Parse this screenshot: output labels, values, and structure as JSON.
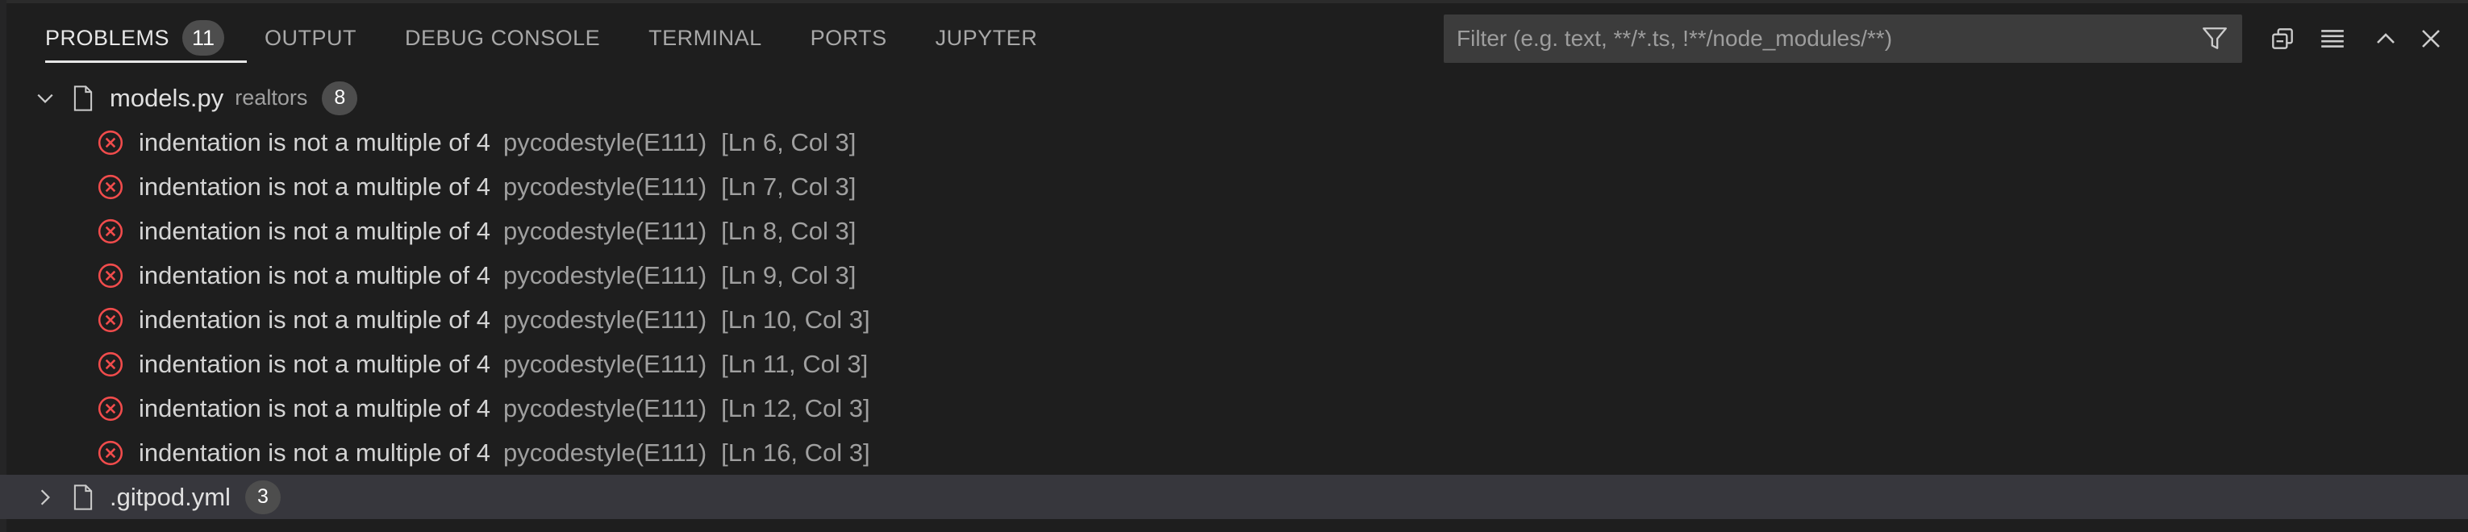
{
  "panel_tabs": [
    {
      "label": "PROBLEMS",
      "active": true,
      "badge": "11"
    },
    {
      "label": "OUTPUT"
    },
    {
      "label": "DEBUG CONSOLE"
    },
    {
      "label": "TERMINAL"
    },
    {
      "label": "PORTS"
    },
    {
      "label": "JUPYTER"
    }
  ],
  "filter": {
    "placeholder": "Filter (e.g. text, **/*.ts, !**/node_modules/**)"
  },
  "files": [
    {
      "name": "models.py",
      "folder": "realtors",
      "count": "8",
      "expanded": true,
      "problems": [
        {
          "message": "indentation is not a multiple of 4",
          "source": "pycodestyle(E111)",
          "location": "[Ln 6, Col 3]"
        },
        {
          "message": "indentation is not a multiple of 4",
          "source": "pycodestyle(E111)",
          "location": "[Ln 7, Col 3]"
        },
        {
          "message": "indentation is not a multiple of 4",
          "source": "pycodestyle(E111)",
          "location": "[Ln 8, Col 3]"
        },
        {
          "message": "indentation is not a multiple of 4",
          "source": "pycodestyle(E111)",
          "location": "[Ln 9, Col 3]"
        },
        {
          "message": "indentation is not a multiple of 4",
          "source": "pycodestyle(E111)",
          "location": "[Ln 10, Col 3]"
        },
        {
          "message": "indentation is not a multiple of 4",
          "source": "pycodestyle(E111)",
          "location": "[Ln 11, Col 3]"
        },
        {
          "message": "indentation is not a multiple of 4",
          "source": "pycodestyle(E111)",
          "location": "[Ln 12, Col 3]"
        },
        {
          "message": "indentation is not a multiple of 4",
          "source": "pycodestyle(E111)",
          "location": "[Ln 16, Col 3]"
        }
      ]
    },
    {
      "name": ".gitpod.yml",
      "count": "3",
      "expanded": false
    }
  ],
  "colors": {
    "background": "#1e1e1e",
    "error": "#f14c4c",
    "badge": "#4d4d4d",
    "selected_row": "#37373d"
  },
  "icons": {
    "filter": "filter-funnel-icon",
    "collapse_all": "collapse-all-icon",
    "view_as_list": "view-as-list-icon",
    "maximize": "chevron-up-icon",
    "close": "close-icon",
    "error": "error-circle-icon",
    "file": "file-icon"
  }
}
